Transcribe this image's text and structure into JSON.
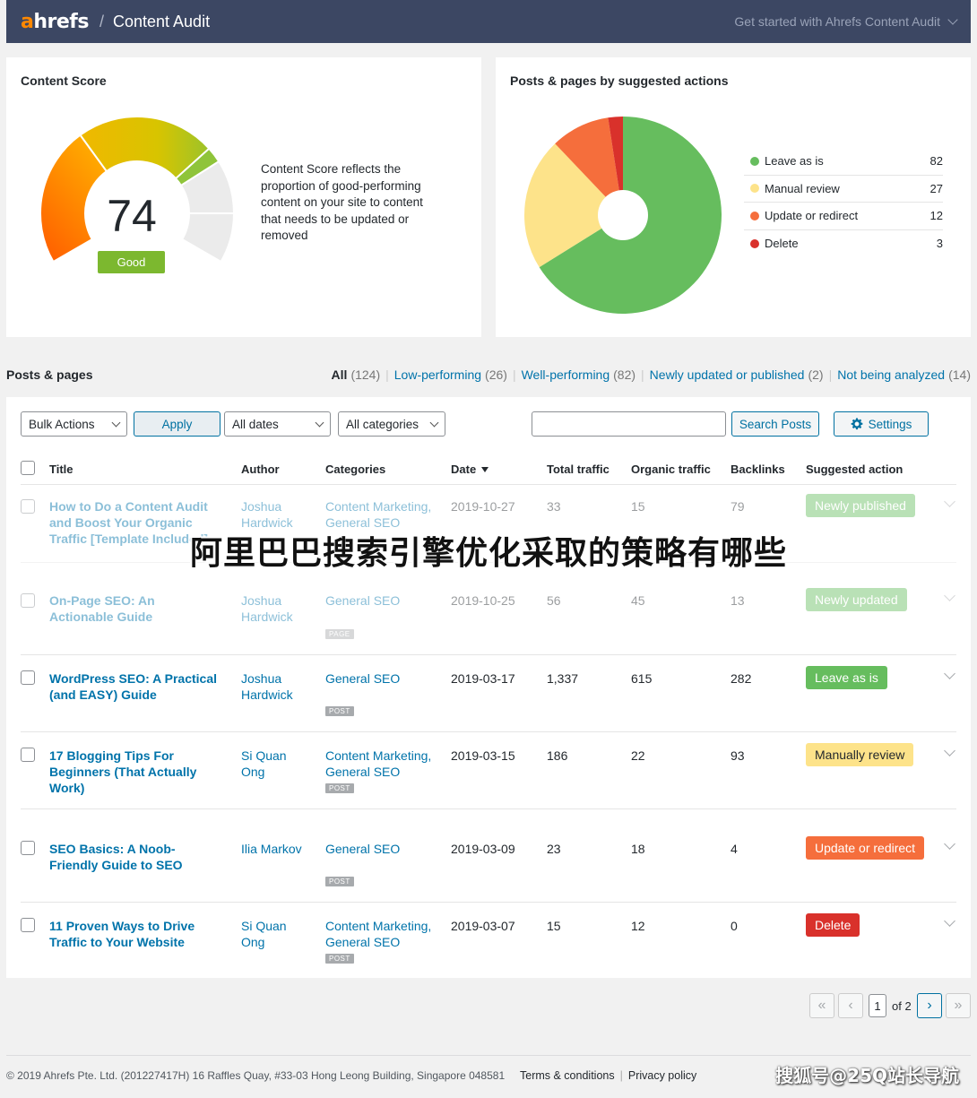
{
  "topbar": {
    "logo_a": "a",
    "logo_rest": "hrefs",
    "separator": "/",
    "title": "Content Audit",
    "get_started": "Get started with Ahrefs Content Audit"
  },
  "score_card": {
    "title": "Content Score",
    "score": "74",
    "rating": "Good",
    "score_fraction": 0.74,
    "description": "Content Score reflects the proportion of good-performing content on your site to content that needs to be updated or removed"
  },
  "actions_card": {
    "title": "Posts & pages by suggested actions",
    "legend": [
      {
        "label": "Leave as is",
        "value": "82",
        "color": "#66bd5e"
      },
      {
        "label": "Manual review",
        "value": "27",
        "color": "#fde38a"
      },
      {
        "label": "Update or redirect",
        "value": "12",
        "color": "#f56e3c"
      },
      {
        "label": "Delete",
        "value": "3",
        "color": "#d9312b"
      }
    ]
  },
  "chart_data": {
    "type": "pie",
    "categories": [
      "Leave as is",
      "Manual review",
      "Update or redirect",
      "Delete"
    ],
    "values": [
      82,
      27,
      12,
      3
    ],
    "colors": [
      "#66bd5e",
      "#fde38a",
      "#f56e3c",
      "#d9312b"
    ],
    "donut": true,
    "legend": "right"
  },
  "posts": {
    "title": "Posts & pages",
    "filters": [
      {
        "label": "All",
        "count": "(124)",
        "current": true
      },
      {
        "label": "Low-performing",
        "count": "(26)"
      },
      {
        "label": "Well-performing",
        "count": "(82)"
      },
      {
        "label": "Newly updated or published",
        "count": "(2)"
      },
      {
        "label": "Not being analyzed",
        "count": "(14)"
      }
    ],
    "bulk_actions": "Bulk Actions",
    "apply": "Apply",
    "dates": "All dates",
    "categories": "All categories",
    "search_value": "",
    "search_button": "Search Posts",
    "settings": "Settings",
    "columns": {
      "title": "Title",
      "author": "Author",
      "categories": "Categories",
      "date": "Date",
      "total_traffic": "Total traffic",
      "organic_traffic": "Organic traffic",
      "backlinks": "Backlinks",
      "suggested_action": "Suggested action"
    },
    "rows": [
      {
        "title": "How to Do a Content Audit and Boost Your Organic Traffic [Template Included]",
        "author": "Joshua Hardwick",
        "categories": "Content Marketing, General SEO",
        "tag": "",
        "date": "2019-10-27",
        "total": "33",
        "organic": "15",
        "backlinks": "79",
        "action": "Newly published",
        "action_color": "#66bd5e"
      },
      {
        "title": "On-Page SEO: An Actionable Guide",
        "author": "Joshua Hardwick",
        "categories": "General SEO",
        "tag": "PAGE",
        "date": "2019-10-25",
        "total": "56",
        "organic": "45",
        "backlinks": "13",
        "action": "Newly updated",
        "action_color": "#66bd5e"
      },
      {
        "title": "WordPress SEO: A Practical (and EASY) Guide",
        "author": "Joshua Hardwick",
        "categories": "General SEO",
        "tag": "POST",
        "date": "2019-03-17",
        "total": "1,337",
        "organic": "615",
        "backlinks": "282",
        "action": "Leave as is",
        "action_color": "#66bd5e"
      },
      {
        "title": "17 Blogging Tips For Beginners (That Actually Work)",
        "author": "Si Quan Ong",
        "categories": "Content Marketing, General SEO",
        "tag": "POST",
        "date": "2019-03-15",
        "total": "186",
        "organic": "22",
        "backlinks": "93",
        "action": "Manually review",
        "action_color": "#fde38a"
      },
      {
        "title": "SEO Basics: A Noob-Friendly Guide to SEO",
        "author": "Ilia Markov",
        "categories": "General SEO",
        "tag": "POST",
        "date": "2019-03-09",
        "total": "23",
        "organic": "18",
        "backlinks": "4",
        "action": "Update or redirect",
        "action_color": "#f56e3c"
      },
      {
        "title": "11 Proven Ways to Drive Traffic to Your Website",
        "author": "Si Quan Ong",
        "categories": "Content Marketing, General SEO",
        "tag": "POST",
        "date": "2019-03-07",
        "total": "15",
        "organic": "12",
        "backlinks": "0",
        "action": "Delete",
        "action_color": "#d9312b"
      }
    ]
  },
  "pagination": {
    "first": "«",
    "prev": "‹",
    "current": "1",
    "of_total": "of 2",
    "next": "›",
    "last": "»"
  },
  "footer": {
    "copyright": "© 2019 Ahrefs Pte. Ltd. (201227417H) 16 Raffles Quay, #33-03 Hong Leong Building, Singapore 048581",
    "terms": "Terms & conditions",
    "privacy": "Privacy policy"
  },
  "overlay": {
    "headline": "阿里巴巴搜索引擎优化采取的策略有哪些",
    "watermark": "搜狐号@25Q站长导航"
  }
}
